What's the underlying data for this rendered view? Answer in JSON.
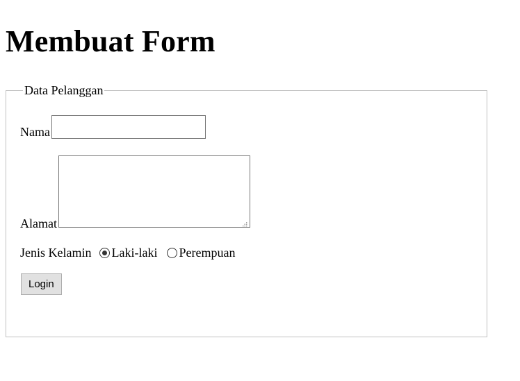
{
  "page": {
    "title": "Membuat Form"
  },
  "form": {
    "legend": "Data Pelanggan",
    "nama": {
      "label": "Nama",
      "value": ""
    },
    "alamat": {
      "label": "Alamat",
      "value": ""
    },
    "gender": {
      "label": "Jenis Kelamin",
      "options": [
        {
          "label": "Laki-laki",
          "checked": true
        },
        {
          "label": "Perempuan",
          "checked": false
        }
      ]
    },
    "submit": {
      "label": "Login"
    }
  },
  "colors": {
    "border": "#c0c0c0",
    "input_border": "#767676",
    "button_bg": "#e1e1e1",
    "button_border": "#adadad"
  },
  "icons": {
    "resize_grip": "resize-grip-icon",
    "radio_selected": "radio-selected-icon",
    "radio_unselected": "radio-unselected-icon"
  }
}
